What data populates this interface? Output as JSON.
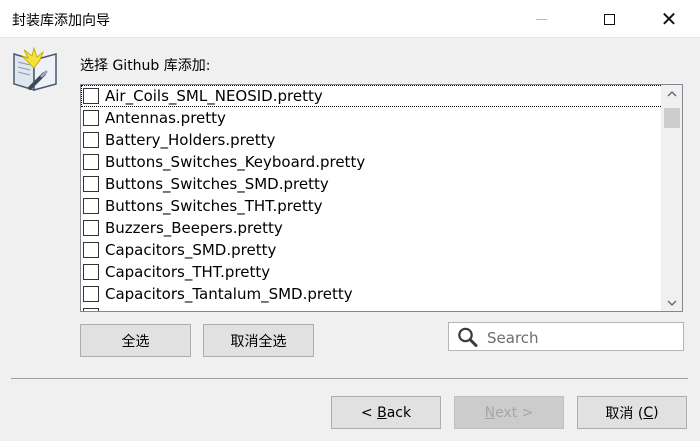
{
  "window": {
    "title": "封装库添加向导",
    "minimize_symbol": "",
    "maximize_symbol": "",
    "close_symbol": "✕"
  },
  "prompt": "选择 Github 库添加:",
  "libraries": [
    {
      "label": "Air_Coils_SML_NEOSID.pretty",
      "checked": false
    },
    {
      "label": "Antennas.pretty",
      "checked": false
    },
    {
      "label": "Battery_Holders.pretty",
      "checked": false
    },
    {
      "label": "Buttons_Switches_Keyboard.pretty",
      "checked": false
    },
    {
      "label": "Buttons_Switches_SMD.pretty",
      "checked": false
    },
    {
      "label": "Buttons_Switches_THT.pretty",
      "checked": false
    },
    {
      "label": "Buzzers_Beepers.pretty",
      "checked": false
    },
    {
      "label": "Capacitors_SMD.pretty",
      "checked": false
    },
    {
      "label": "Capacitors_THT.pretty",
      "checked": false
    },
    {
      "label": "Capacitors_Tantalum_SMD.pretty",
      "checked": false
    }
  ],
  "buttons": {
    "select_all": "全选",
    "deselect_all": "取消全选",
    "back_prefix": "< ",
    "back_mnemonic": "B",
    "back_rest": "ack",
    "next_mnemonic": "N",
    "next_rest": "ext >",
    "cancel_prefix": "取消 (",
    "cancel_mnemonic": "C",
    "cancel_suffix": ")"
  },
  "search": {
    "placeholder": "Search",
    "value": ""
  },
  "icons": {
    "wizard": "wizard-book-wand-icon",
    "search": "magnifier-icon"
  }
}
